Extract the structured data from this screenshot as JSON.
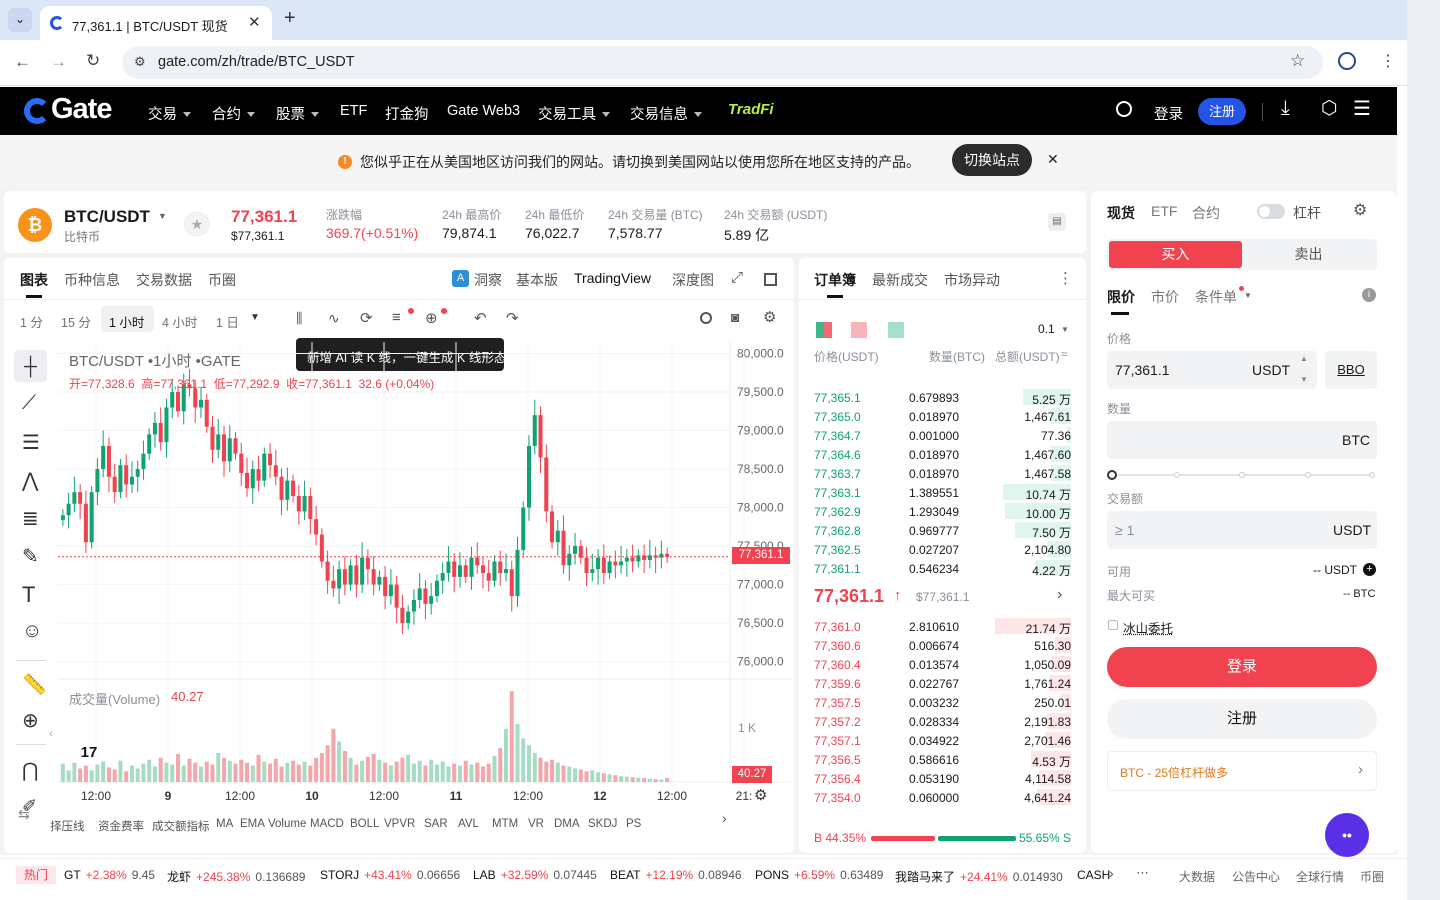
{
  "browser": {
    "tab_title": "77,361.1 | BTC/USDT 现货",
    "url": "gate.com/zh/trade/BTC_USDT"
  },
  "nav": {
    "logo": "Gate",
    "items": [
      "交易",
      "合约",
      "股票",
      "ETF",
      "打金狗",
      "Gate Web3",
      "交易工具",
      "交易信息"
    ],
    "tradfi": "TradFi",
    "login": "登录",
    "register": "注册"
  },
  "notice": {
    "text": "您似乎正在从美国地区访问我们的网站。请切换到美国网站以使用您所在地区支持的产品。",
    "switch": "切换站点"
  },
  "pair": {
    "symbol": "BTC/USDT",
    "name": "比特币",
    "price": "77,361.1",
    "price_sub": "$77,361.1",
    "stats": [
      {
        "label": "涨跌幅",
        "value": "369.7(+0.51%)"
      },
      {
        "label": "24h 最高价",
        "value": "79,874.1"
      },
      {
        "label": "24h 最低价",
        "value": "76,022.7"
      },
      {
        "label": "24h 交易量 (BTC)",
        "value": "7,578.77"
      },
      {
        "label": "24h 交易额 (USDT)",
        "value": "5.89 亿"
      }
    ]
  },
  "chart_tabs": {
    "tabs": [
      "图表",
      "币种信息",
      "交易数据",
      "币圈"
    ],
    "insight": "洞察",
    "basic": "基本版",
    "tradingview": "TradingView",
    "depth": "深度图"
  },
  "intervals": [
    "1 分",
    "15 分",
    "1 小时",
    "4 小时",
    "1 日"
  ],
  "tooltip": "新增 AI 读 K 线，一键生成 K 线形态",
  "chart_info": {
    "title": "BTC/USDT •1小时 •GATE",
    "ohlc": "开=77,328.6  高=77,361.1  低=77,292.9  收=77,361.1  32.6 (+0.04%)",
    "volume_label": "成交量(Volume)",
    "volume_value": "40.27",
    "last_tag": "77,361.1",
    "vol_tag": "40.27",
    "vol_axis": "1 K"
  },
  "indicators": [
    "择压线",
    "资金费率",
    "成交额指标",
    "MA",
    "EMA",
    "Volume",
    "MACD",
    "BOLL",
    "VPVR",
    "SAR",
    "AVL",
    "MTM",
    "VR",
    "DMA",
    "SKDJ",
    "PS"
  ],
  "chart_data": {
    "type": "candlestick",
    "title": "BTC/USDT •1小时 •GATE",
    "ylim": [
      75800,
      80150
    ],
    "y_ticks": [
      "80,000.0",
      "79,500.0",
      "79,000.0",
      "78,500.0",
      "78,000.0",
      "77,500.0",
      "77,000.0",
      "76,500.0",
      "76,000.0"
    ],
    "x_ticks": [
      "12:00",
      "9",
      "12:00",
      "10",
      "12:00",
      "11",
      "12:00",
      "12",
      "12:00",
      "21:"
    ],
    "close": [
      77900,
      78050,
      78200,
      78050,
      77550,
      78200,
      78500,
      78800,
      78400,
      78200,
      78550,
      78300,
      78400,
      78500,
      78700,
      78950,
      79100,
      78850,
      79300,
      79500,
      79250,
      79600,
      79550,
      79300,
      79400,
      79050,
      78750,
      78950,
      78600,
      78900,
      78700,
      78450,
      78250,
      78500,
      78350,
      78700,
      78550,
      78400,
      78100,
      78350,
      78150,
      77950,
      78150,
      77850,
      77650,
      77300,
      77050,
      76950,
      77200,
      77000,
      77250,
      77000,
      77350,
      77200,
      77000,
      77100,
      76850,
      77000,
      76700,
      76500,
      76650,
      76800,
      76950,
      76750,
      76850,
      77050,
      77150,
      77300,
      77100,
      77250,
      77100,
      77350,
      77250,
      77150,
      77050,
      77300,
      77150,
      77200,
      76850,
      77450,
      78000,
      78800,
      79200,
      78650,
      77950,
      77550,
      77700,
      77250,
      77400,
      77500,
      77350,
      77150,
      77200,
      77350,
      77150,
      77300,
      77250,
      77300,
      77350,
      77300,
      77380,
      77320,
      77380,
      77350,
      77400,
      77361
    ],
    "volume": [
      190,
      120,
      200,
      140,
      260,
      120,
      180,
      210,
      150,
      130,
      220,
      110,
      170,
      140,
      190,
      230,
      160,
      250,
      200,
      180,
      290,
      170,
      240,
      200,
      160,
      210,
      180,
      300,
      250,
      220,
      190,
      230,
      200,
      170,
      280,
      210,
      190,
      240,
      160,
      200,
      220,
      180,
      210,
      170,
      250,
      300,
      380,
      550,
      420,
      320,
      250,
      180,
      220,
      260,
      290,
      230,
      200,
      170,
      210,
      250,
      280,
      190,
      220,
      170,
      230,
      180,
      210,
      160,
      190,
      170,
      220,
      180,
      200,
      160,
      190,
      270,
      350,
      550,
      940,
      600,
      450,
      380,
      300,
      250,
      210,
      230,
      200,
      170,
      160,
      140,
      130,
      110,
      120,
      100,
      90,
      80,
      70,
      60,
      55,
      50,
      45,
      40,
      35,
      30,
      25,
      40
    ]
  },
  "orderbook": {
    "tabs": [
      "订单簿",
      "最新成交",
      "市场异动"
    ],
    "precision": "0.1",
    "headers": [
      "价格(USDT)",
      "数量(BTC)",
      "总额(USDT)"
    ],
    "asks": [
      [
        "77,365.1",
        "0.679893",
        "5.25 万"
      ],
      [
        "77,365.0",
        "0.018970",
        "1,467.61"
      ],
      [
        "77,364.7",
        "0.001000",
        "77.36"
      ],
      [
        "77,364.6",
        "0.018970",
        "1,467.60"
      ],
      [
        "77,363.7",
        "0.018970",
        "1,467.58"
      ],
      [
        "77,363.1",
        "1.389551",
        "10.74 万"
      ],
      [
        "77,362.9",
        "1.293049",
        "10.00 万"
      ],
      [
        "77,362.8",
        "0.969777",
        "7.50 万"
      ],
      [
        "77,362.5",
        "0.027207",
        "2,104.80"
      ],
      [
        "77,361.1",
        "0.546234",
        "4.22 万"
      ]
    ],
    "ask_depth": [
      0.6,
      0.25,
      0.05,
      0.25,
      0.25,
      0.85,
      0.82,
      0.7,
      0.3,
      0.45
    ],
    "mid": "77,361.1",
    "mid_sub": "$77,361.1",
    "bids": [
      [
        "77,361.0",
        "2.810610",
        "21.74 万"
      ],
      [
        "77,360.6",
        "0.006674",
        "516.30"
      ],
      [
        "77,360.4",
        "0.013574",
        "1,050.09"
      ],
      [
        "77,359.6",
        "0.022767",
        "1,761.24"
      ],
      [
        "77,357.5",
        "0.003232",
        "250.01"
      ],
      [
        "77,357.2",
        "0.028334",
        "2,191.83"
      ],
      [
        "77,357.1",
        "0.034922",
        "2,701.46"
      ],
      [
        "77,356.5",
        "0.586616",
        "4.53 万"
      ],
      [
        "77,356.4",
        "0.053190",
        "4,114.58"
      ],
      [
        "77,354.0",
        "0.060000",
        "4,641.24"
      ]
    ],
    "bid_depth": [
      0.95,
      0.2,
      0.25,
      0.28,
      0.12,
      0.3,
      0.33,
      0.5,
      0.4,
      0.42
    ],
    "buy_pct": "B 44.35%",
    "sell_pct": "55.65% S",
    "buy_ratio": 0.4435
  },
  "trade": {
    "tabs": [
      "现货",
      "ETF",
      "合约"
    ],
    "leverage": "杠杆",
    "buy": "买入",
    "sell": "卖出",
    "order_types": [
      "限价",
      "市价",
      "条件单"
    ],
    "price_label": "价格",
    "price_value": "77,361.1",
    "price_unit": "USDT",
    "bbo": "BBO",
    "qty_label": "数量",
    "qty_unit": "BTC",
    "amount_label": "交易额",
    "amount_placeholder": "≥ 1",
    "amount_unit": "USDT",
    "available_label": "可用",
    "available_value": "-- USDT",
    "max_label": "最大可买",
    "max_value": "-- BTC",
    "iceberg": "冰山委托",
    "login_btn": "登录",
    "register_btn": "注册",
    "promo": "BTC - 25倍杠杆做多"
  },
  "ticker": {
    "hot": "热门",
    "items": [
      [
        "GT",
        "+2.38%",
        "9.45"
      ],
      [
        "龙虾",
        "+245.38%",
        "0.136689"
      ],
      [
        "STORJ",
        "+43.41%",
        "0.06656"
      ],
      [
        "LAB",
        "+32.59%",
        "0.07445"
      ],
      [
        "BEAT",
        "+12.19%",
        "0.08946"
      ],
      [
        "PONS",
        "+6.59%",
        "0.63489"
      ],
      [
        "我踏马来了",
        "+24.41%",
        "0.014930"
      ],
      [
        "CASH",
        "",
        ""
      ]
    ],
    "links": [
      "大数据",
      "公告中心",
      "全球行情",
      "币圈"
    ]
  }
}
